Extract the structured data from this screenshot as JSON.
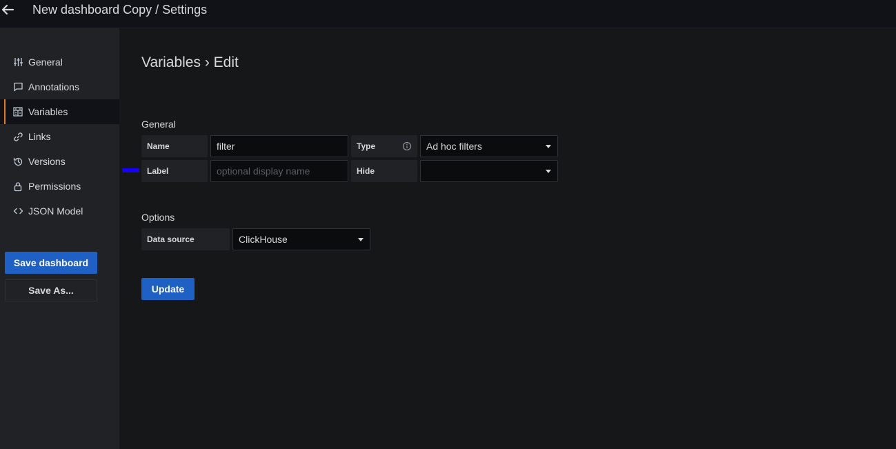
{
  "header": {
    "title": "New dashboard Copy / Settings"
  },
  "sidebar": {
    "items": [
      {
        "label": "General",
        "icon": "sliders-icon"
      },
      {
        "label": "Annotations",
        "icon": "comment-icon"
      },
      {
        "label": "Variables",
        "icon": "calculator-icon",
        "active": true
      },
      {
        "label": "Links",
        "icon": "link-icon"
      },
      {
        "label": "Versions",
        "icon": "history-icon"
      },
      {
        "label": "Permissions",
        "icon": "lock-icon"
      },
      {
        "label": "JSON Model",
        "icon": "code-icon"
      }
    ],
    "save_label": "Save dashboard",
    "save_as_label": "Save As..."
  },
  "main": {
    "heading": "Variables › Edit",
    "general": {
      "title": "General",
      "name_label": "Name",
      "name_value": "filter",
      "type_label": "Type",
      "type_value": "Ad hoc filters",
      "label_label": "Label",
      "label_placeholder": "optional display name",
      "hide_label": "Hide",
      "hide_value": ""
    },
    "options": {
      "title": "Options",
      "datasource_label": "Data source",
      "datasource_value": "ClickHouse"
    },
    "update_label": "Update"
  },
  "colors": {
    "accent": "#1f60c4",
    "active_indicator": "#eb7b18",
    "marker": "#1500ff"
  }
}
